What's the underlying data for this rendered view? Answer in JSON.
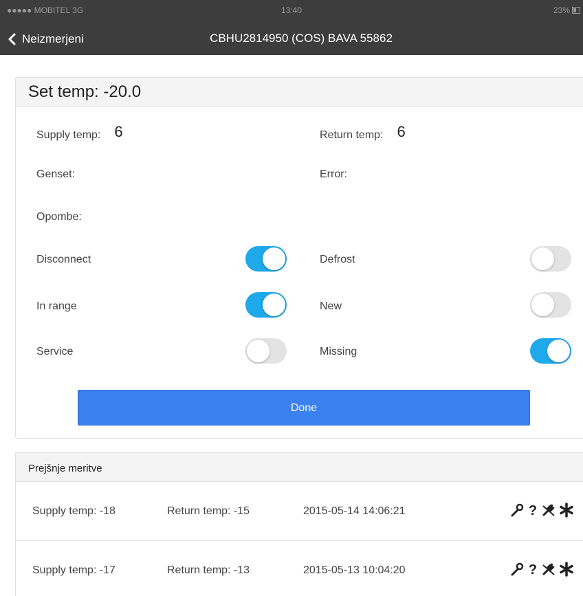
{
  "status_bar": {
    "carrier": "●●●●● MOBITEL  3G",
    "time": "13:40",
    "battery": "23%"
  },
  "nav": {
    "back_label": "Neizmerjeni",
    "back_icon": "chevron-left-icon",
    "title": "CBHU2814950 (COS) BAVA 55862"
  },
  "form": {
    "heading": "Set temp: -20.0",
    "supply_label": "Supply temp:",
    "supply_value": "6",
    "return_label": "Return temp:",
    "return_value": "6",
    "genset_label": "Genset:",
    "error_label": "Error:",
    "notes_label": "Opombe:",
    "toggles": [
      {
        "label": "Disconnect",
        "on": true
      },
      {
        "label": "Defrost",
        "on": false
      },
      {
        "label": "In range",
        "on": true
      },
      {
        "label": "New",
        "on": false
      },
      {
        "label": "Service",
        "on": false
      },
      {
        "label": "Missing",
        "on": true
      }
    ],
    "done_label": "Done",
    "accent_color": "#1fa8ea",
    "button_color": "#3a80ee"
  },
  "history": {
    "heading": "Prejšnje meritve",
    "rows": [
      {
        "supply": "Supply temp: -18",
        "return": "Return temp: -15",
        "timestamp": "2015-05-14 14:06:21",
        "icons": [
          "wrench-icon",
          "question-icon",
          "unplugged-icon",
          "snowflake-icon"
        ]
      },
      {
        "supply": "Supply temp: -17",
        "return": "Return temp: -13",
        "timestamp": "2015-05-13 10:04:20",
        "icons": [
          "wrench-icon",
          "question-icon",
          "unplugged-icon",
          "snowflake-icon"
        ]
      }
    ]
  }
}
